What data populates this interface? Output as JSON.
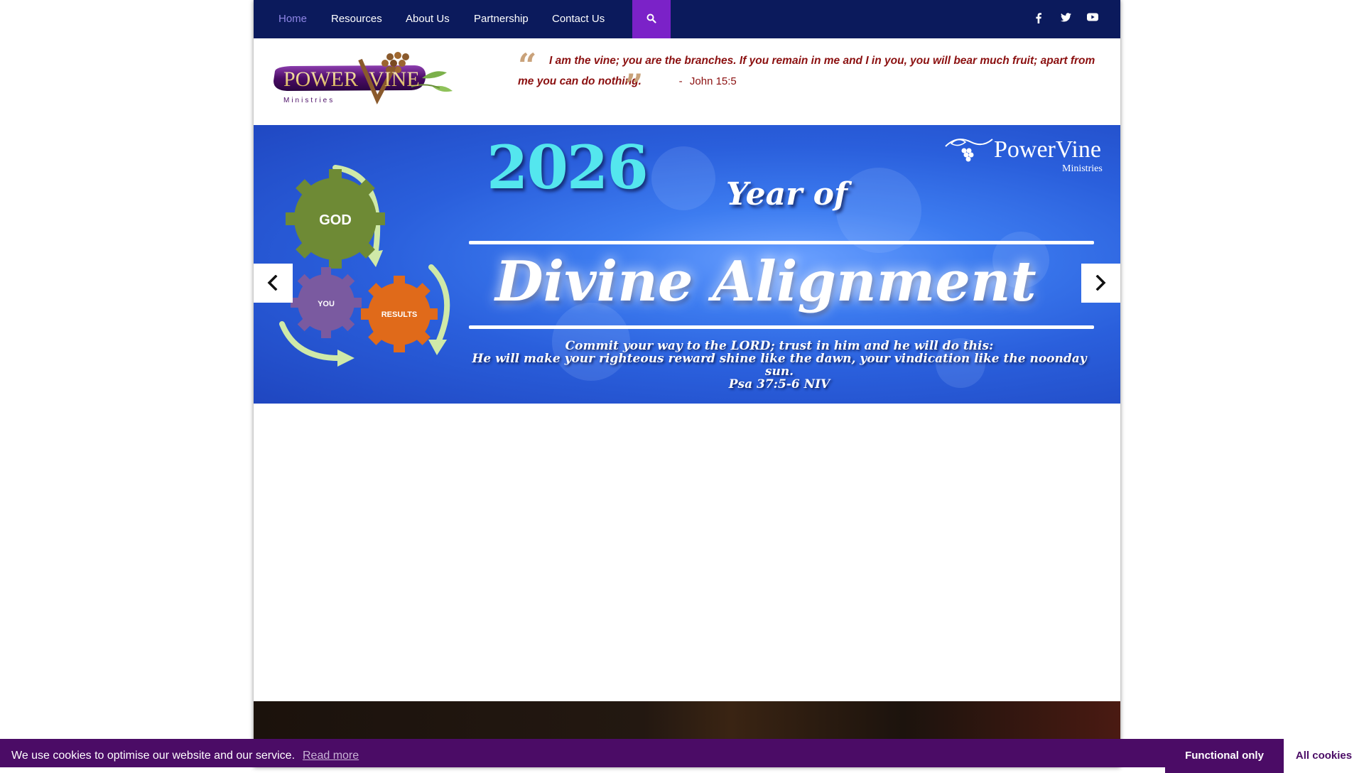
{
  "nav": {
    "items": [
      {
        "label": "Home",
        "active": true
      },
      {
        "label": "Resources",
        "active": false
      },
      {
        "label": "About Us",
        "active": false
      },
      {
        "label": "Partnership",
        "active": false
      },
      {
        "label": "Contact Us",
        "active": false
      }
    ],
    "search_icon": "search-icon",
    "social": [
      "facebook-icon",
      "twitter-icon",
      "youtube-icon"
    ],
    "colors": {
      "bar": "#0b1a5c",
      "active": "#8f86e6",
      "search_bg": "#7b22c8"
    }
  },
  "logo": {
    "text_power": "POWER",
    "text_vine": "VINE",
    "text_sub": "Ministries"
  },
  "quote": {
    "text": "I am the vine; you are the branches. If you remain in me and I in you, you will bear much fruit; apart from me you can do nothing.",
    "separator": "-",
    "reference": "John 15:5",
    "color": "#8b1010"
  },
  "slider": {
    "year": "2026",
    "year_of": "Year of",
    "title": "Divine Alignment",
    "verse_line1": "Commit your way to the LORD; trust in him and he will do this:",
    "verse_line2": "He will make your righteous reward shine like the dawn, your vindication like the noonday sun.",
    "verse_ref": "Psa 37:5-6 NIV",
    "brand": "PowerVine",
    "brand_sub": "Ministries",
    "gears": {
      "top": "GOD",
      "left": "YOU",
      "right": "RESULTS"
    }
  },
  "cookie": {
    "message": "We use cookies to optimise our website and our service.",
    "read_more": "Read more",
    "functional_label": "Functional only",
    "all_label": "All cookies",
    "bar_color": "#4b0c66"
  }
}
